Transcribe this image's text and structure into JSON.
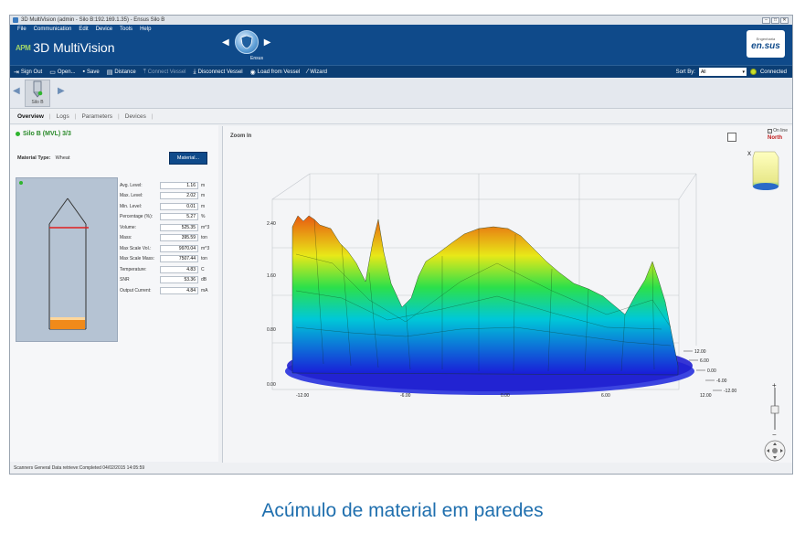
{
  "window": {
    "title": "3D MultiVision (admin - Silo B:192.169.1.35) - Ensus Silo B",
    "controls": [
      "–",
      "□",
      "✕"
    ]
  },
  "menu": [
    "File",
    "Communication",
    "Edit",
    "Device",
    "Tools",
    "Help"
  ],
  "app": {
    "logo_mark": "APM",
    "name": "3D MultiVision"
  },
  "center_nav": {
    "label": "Ensus"
  },
  "brand": {
    "tagline": "Engenharia",
    "name": "en.sus"
  },
  "toolbar": {
    "sign_out": "Sign Out",
    "open": "Open...",
    "save": "Save",
    "distance": "Distance",
    "connect": "Connect Vessel",
    "disconnect": "Disconnect Vessel",
    "load": "Load from Vessel",
    "wizard": "Wizard",
    "sort_label": "Sort By:",
    "sort_value": "All",
    "connected": "Connected"
  },
  "vessel": {
    "label": "Silo B"
  },
  "tabs": [
    "Overview",
    "Logs",
    "Parameters",
    "Devices"
  ],
  "overview": {
    "title": "Silo B (MVL) 3/3",
    "material_label": "Material Type:",
    "material_value": "Wheat",
    "material_button": "Material...",
    "metrics": [
      {
        "label": "Avg. Level:",
        "value": "1.16",
        "unit": "m"
      },
      {
        "label": "Max. Level:",
        "value": "2.02",
        "unit": "m"
      },
      {
        "label": "Min. Level:",
        "value": "0.01",
        "unit": "m"
      },
      {
        "label": "Percentage (%):",
        "value": "5.27",
        "unit": "%"
      },
      {
        "label": "Volume:",
        "value": "525.35",
        "unit": "m^3"
      },
      {
        "label": "Mass:",
        "value": "395.59",
        "unit": "ton"
      },
      {
        "label": "Max Scale Vol.:",
        "value": "9970.04",
        "unit": "m^3"
      },
      {
        "label": "Max Scale Mass:",
        "value": "7507.44",
        "unit": "ton"
      },
      {
        "label": "Temperature:",
        "value": "4.83",
        "unit": "C"
      },
      {
        "label": "SNR",
        "value": "53.36",
        "unit": "dB"
      },
      {
        "label": "Output Current:",
        "value": "4.84",
        "unit": "mA"
      }
    ]
  },
  "viewer": {
    "zoom": "Zoom In",
    "online": "On line",
    "north": "North",
    "axis_x_marker": "X",
    "z_ticks": [
      "2.40",
      "1.60",
      "0.80",
      "0.00"
    ],
    "x_ticks": [
      "-12.00",
      "-6.00",
      "0.00",
      "6.00",
      "12.00"
    ],
    "y_ticks": [
      "12.00",
      "6.00",
      "0.00",
      "-6.00",
      "-12.00"
    ]
  },
  "status_text": "Scanners General Data retrieve:Completed 04/02/2015 14:05:59",
  "caption": "Acúmulo de material em paredes",
  "colors": {
    "header": "#0f4a8a",
    "toolbar": "#0b3e74",
    "caption": "#1f6fae",
    "connected": "#c8e02a"
  }
}
